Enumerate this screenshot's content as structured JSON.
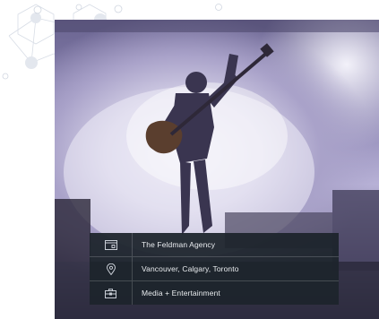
{
  "hero": {
    "image": "concert-guitarist-photo"
  },
  "info_card": {
    "rows": [
      {
        "icon": "calendar-icon",
        "text": "The Feldman Agency"
      },
      {
        "icon": "location-pin-icon",
        "text": "Vancouver, Calgary, Toronto"
      },
      {
        "icon": "briefcase-icon",
        "text": "Media + Entertainment"
      }
    ]
  },
  "colors": {
    "card_background": "#1d242c",
    "card_text": "#e9ecef"
  }
}
